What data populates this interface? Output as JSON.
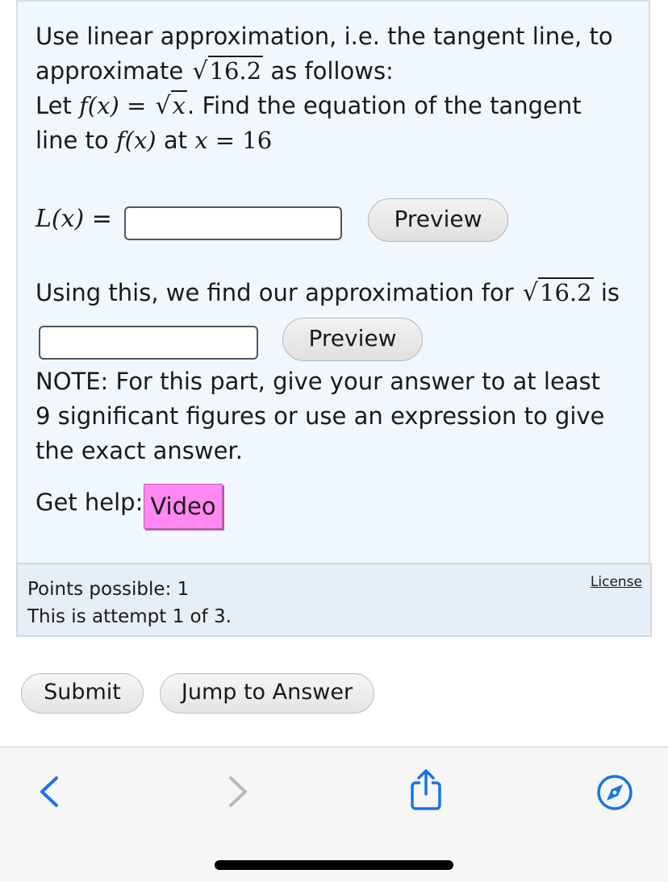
{
  "question": {
    "line1": "Use linear approximation, i.e. the tangent line, to",
    "line2_pre": "approximate ",
    "radicand": "16.2",
    "line2_post": " as follows:",
    "line3_pre": "Let ",
    "fx": "f(x)",
    "eq": " = ",
    "sqrt_x": "x",
    "line3_post": ". Find the equation of the tangent",
    "line4_pre": "line to ",
    "line4_mid": " at ",
    "x_var": "x",
    "x_eq": " = ",
    "x_val": "16"
  },
  "lx": {
    "label": "L(x)",
    "equals": " =",
    "input_value": "",
    "preview_label": "Preview"
  },
  "approx": {
    "sentence_pre": "Using this, we find our approximation for ",
    "radicand": "16.2",
    "sentence_post": " is",
    "input_value": "",
    "preview_label": "Preview"
  },
  "note": "NOTE: For this part, give your answer to at least 9 significant figures or use an expression to give the exact answer.",
  "help": {
    "label": "Get help: ",
    "video_label": "Video"
  },
  "footer": {
    "points": "Points possible: 1",
    "attempt": "This is attempt 1 of 3.",
    "license": "License"
  },
  "actions": {
    "submit": "Submit",
    "jump": "Jump to Answer"
  },
  "browser_toolbar": {
    "icons": [
      "back-icon",
      "forward-icon",
      "share-icon",
      "compass-icon"
    ],
    "accent": "#1a73e8"
  }
}
